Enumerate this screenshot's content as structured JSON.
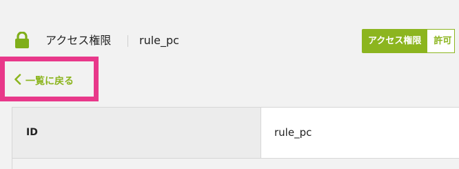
{
  "header": {
    "icon": "lock-icon",
    "title": "アクセス権限",
    "subtitle": "rule_pc",
    "tabs": [
      {
        "label": "アクセス権限",
        "active": true
      },
      {
        "label": "許可",
        "active": false
      }
    ]
  },
  "back_link": {
    "icon": "chevron-left-icon",
    "label": "一覧に戻る"
  },
  "table": {
    "rows": [
      {
        "label": "ID",
        "value": "rule_pc"
      }
    ]
  },
  "colors": {
    "accent": "#8cb51f",
    "highlight": "#e8388a",
    "background": "#f2f2f2",
    "icon": "#7fae1a"
  }
}
